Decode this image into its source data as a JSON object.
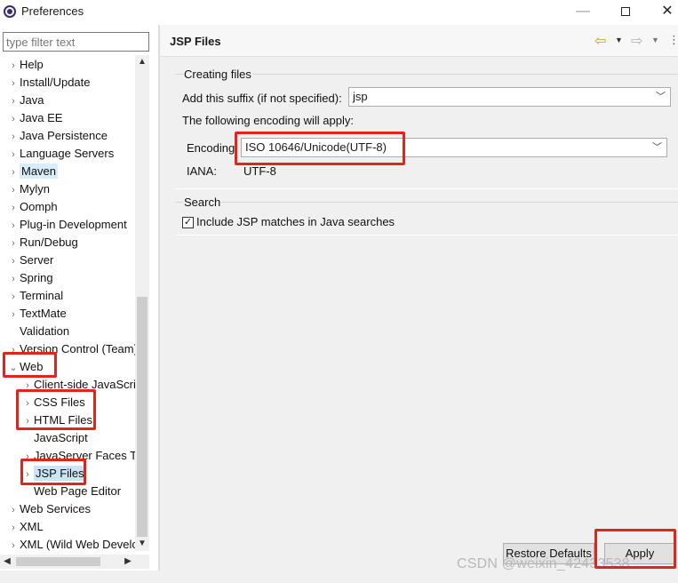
{
  "window": {
    "title": "Preferences",
    "minimize_glyph": "—",
    "close_glyph": "✕"
  },
  "sidebar": {
    "filter_placeholder": "type filter text",
    "items": [
      {
        "label": "Help",
        "arrow": "›"
      },
      {
        "label": "Install/Update",
        "arrow": "›"
      },
      {
        "label": "Java",
        "arrow": "›"
      },
      {
        "label": "Java EE",
        "arrow": "›"
      },
      {
        "label": "Java Persistence",
        "arrow": "›"
      },
      {
        "label": "Language Servers",
        "arrow": "›"
      },
      {
        "label": "Maven",
        "arrow": "›"
      },
      {
        "label": "Mylyn",
        "arrow": "›"
      },
      {
        "label": "Oomph",
        "arrow": "›"
      },
      {
        "label": "Plug-in Development",
        "arrow": "›"
      },
      {
        "label": "Run/Debug",
        "arrow": "›"
      },
      {
        "label": "Server",
        "arrow": "›"
      },
      {
        "label": "Spring",
        "arrow": "›"
      },
      {
        "label": "Terminal",
        "arrow": "›"
      },
      {
        "label": "TextMate",
        "arrow": "›"
      },
      {
        "label": "Validation",
        "arrow": ""
      },
      {
        "label": "Version Control (Team)",
        "arrow": "›"
      },
      {
        "label": "Web",
        "arrow": "⌄"
      },
      {
        "label": "Client-side JavaScript",
        "arrow": "›"
      },
      {
        "label": "CSS Files",
        "arrow": "›"
      },
      {
        "label": "HTML Files",
        "arrow": "›"
      },
      {
        "label": "JavaScript",
        "arrow": ""
      },
      {
        "label": "JavaServer Faces Tools",
        "arrow": "›"
      },
      {
        "label": "JSP Files",
        "arrow": "›"
      },
      {
        "label": "Web Page Editor",
        "arrow": ""
      },
      {
        "label": "Web Services",
        "arrow": "›"
      },
      {
        "label": "XML",
        "arrow": "›"
      },
      {
        "label": "XML (Wild Web Developer)",
        "arrow": "›"
      }
    ],
    "selected": "JSP Files"
  },
  "page": {
    "title": "JSP Files",
    "creating_files": {
      "group_title": "Creating files",
      "suffix_label": "Add this suffix (if not specified):",
      "suffix_value": "jsp",
      "encoding_apply_label": "The following encoding will apply:",
      "encoding_label": "Encoding",
      "encoding_value": "ISO 10646/Unicode(UTF-8)",
      "iana_label": "IANA:",
      "iana_value": "UTF-8"
    },
    "search": {
      "group_title": "Search",
      "include_label": "Include JSP matches in Java searches",
      "include_checked": true
    }
  },
  "buttons": {
    "restore_defaults": "Restore Defaults",
    "apply": "Apply"
  },
  "watermark": "CSDN @weixin_42433538",
  "colors": {
    "selection": "#cce4f7",
    "annotation_red": "#e0261b"
  }
}
